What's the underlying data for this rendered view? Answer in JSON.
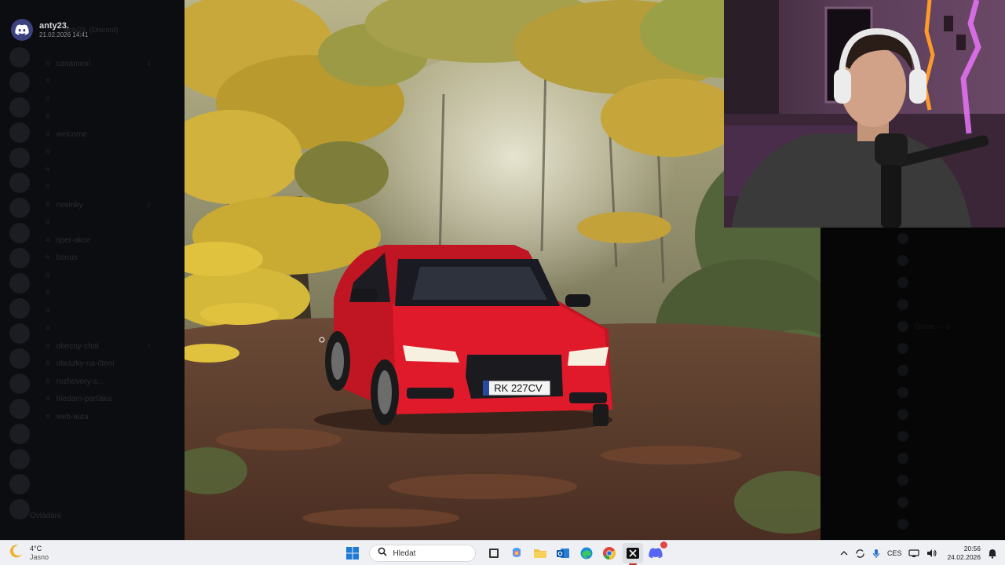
{
  "notification": {
    "username": "anty23.",
    "timestamp": "21.02.2026 14:41",
    "subtitle": "anty23. (Discord)"
  },
  "sidebar": {
    "channels": [
      {
        "name": "oznámení",
        "count": "4"
      },
      {
        "name": "",
        "count": ""
      },
      {
        "name": "",
        "count": ""
      },
      {
        "name": "",
        "count": ""
      },
      {
        "name": "welcome",
        "count": ""
      },
      {
        "name": "",
        "count": ""
      },
      {
        "name": "",
        "count": ""
      },
      {
        "name": "",
        "count": ""
      },
      {
        "name": "novinky",
        "count": "2"
      },
      {
        "name": "",
        "count": ""
      },
      {
        "name": "tiper-akce",
        "count": ""
      },
      {
        "name": "bonus",
        "count": ""
      },
      {
        "name": "",
        "count": ""
      },
      {
        "name": "",
        "count": ""
      },
      {
        "name": "",
        "count": ""
      },
      {
        "name": "",
        "count": ""
      },
      {
        "name": "obecny-chat",
        "count": "3"
      },
      {
        "name": "obrázky-na-čtení",
        "count": ""
      },
      {
        "name": "rozhovory-s...",
        "count": ""
      },
      {
        "name": "hledam-parťáka",
        "count": ""
      },
      {
        "name": "web-auta",
        "count": ""
      }
    ],
    "bottom_label": "Ovládání"
  },
  "right_panel": {
    "members": [
      "",
      "",
      "",
      "",
      "Online — 6",
      "",
      "",
      "",
      "",
      "",
      "",
      "",
      "",
      ""
    ]
  },
  "photo": {
    "plate": "RK 227CV",
    "car_color": "#e01a2a"
  },
  "taskbar": {
    "weather": {
      "temp": "4°C",
      "condition": "Jasno"
    },
    "search_placeholder": "Hledat",
    "tray": {
      "lang": "CES",
      "time": "20:56",
      "date": "24.02.2026"
    },
    "apps": [
      {
        "name": "start-icon"
      },
      {
        "name": "task-view-icon"
      },
      {
        "name": "copilot-icon"
      },
      {
        "name": "file-explorer-icon"
      },
      {
        "name": "outlook-icon"
      },
      {
        "name": "edge-icon"
      },
      {
        "name": "chrome-icon"
      },
      {
        "name": "capcut-icon"
      },
      {
        "name": "discord-icon"
      }
    ]
  }
}
